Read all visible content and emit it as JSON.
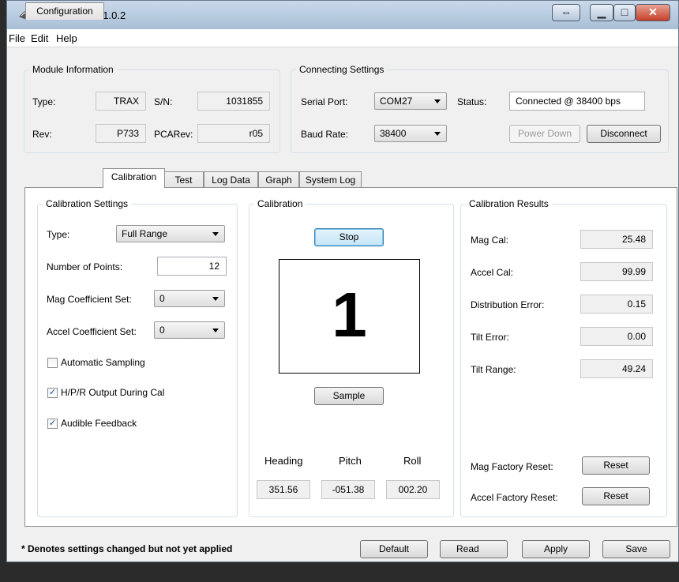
{
  "window": {
    "title": "TRAX Studio v1.0.2",
    "controls": {
      "restore": "⇔",
      "minimize": "▁",
      "maximize": "□",
      "close": "✕"
    }
  },
  "menu": [
    "File",
    "Edit",
    "Help"
  ],
  "module_info": {
    "legend": "Module Information",
    "type_label": "Type:",
    "type_value": "TRAX",
    "sn_label": "S/N:",
    "sn_value": "1031855",
    "rev_label": "Rev:",
    "rev_value": "P733",
    "pcarev_label": "PCARev:",
    "pcarev_value": "r05"
  },
  "connecting": {
    "legend": "Connecting Settings",
    "serial_label": "Serial Port:",
    "serial_value": "COM27",
    "status_label": "Status:",
    "status_value": "Connected @ 38400 bps",
    "baud_label": "Baud Rate:",
    "baud_value": "38400",
    "power_down": "Power Down",
    "disconnect": "Disconnect"
  },
  "tabs": [
    "Configuration",
    "Calibration",
    "Test",
    "Log Data",
    "Graph",
    "System Log"
  ],
  "active_tab": "Calibration",
  "cal_settings": {
    "legend": "Calibration Settings",
    "type_label": "Type:",
    "type_value": "Full Range",
    "points_label": "Number of Points:",
    "points_value": "12",
    "mag_label": "Mag Coefficient Set:",
    "mag_value": "0",
    "accel_label": "Accel Coefficient Set:",
    "accel_value": "0",
    "auto_sampling": {
      "label": "Automatic Sampling",
      "checked": false
    },
    "hpr_output": {
      "label": "H/P/R Output During Cal",
      "checked": true
    },
    "audible": {
      "label": "Audible Feedback",
      "checked": true
    }
  },
  "calibration": {
    "legend": "Calibration",
    "stop": "Stop",
    "sample_count": "1",
    "sample": "Sample",
    "heading_label": "Heading",
    "heading_value": "351.56",
    "pitch_label": "Pitch",
    "pitch_value": "-051.38",
    "roll_label": "Roll",
    "roll_value": "002.20"
  },
  "results": {
    "legend": "Calibration Results",
    "mag_cal_label": "Mag Cal:",
    "mag_cal_value": "25.48",
    "accel_cal_label": "Accel Cal:",
    "accel_cal_value": "99.99",
    "dist_label": "Distribution Error:",
    "dist_value": "0.15",
    "tilt_err_label": "Tilt Error:",
    "tilt_err_value": "0.00",
    "tilt_range_label": "Tilt Range:",
    "tilt_range_value": "49.24",
    "mag_reset_label": "Mag Factory Reset:",
    "mag_reset_btn": "Reset",
    "accel_reset_label": "Accel Factory Reset:",
    "accel_reset_btn": "Reset"
  },
  "footer": {
    "note": "* Denotes settings changed but not yet applied",
    "default": "Default",
    "read": "Read",
    "apply": "Apply",
    "save": "Save"
  }
}
